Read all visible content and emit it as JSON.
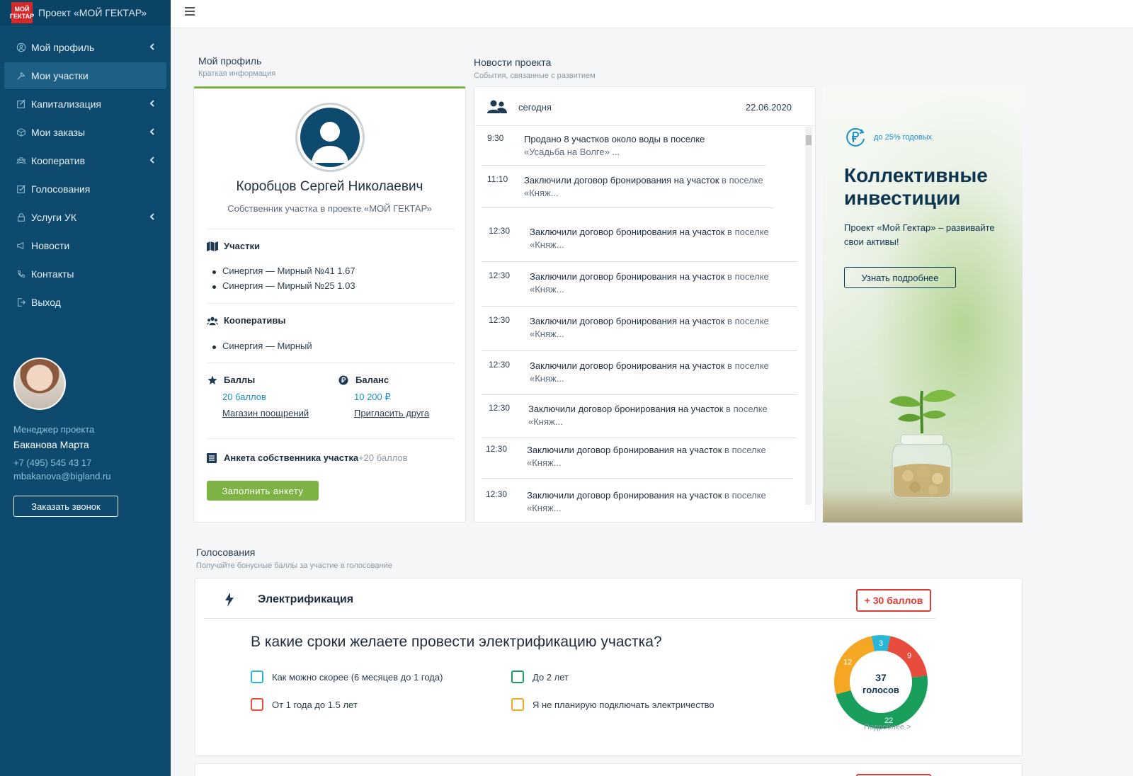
{
  "brand": {
    "logo_line1": "МОЙ",
    "logo_line2": "ГЕКТАР",
    "title": "Проект «МОЙ ГЕКТАР»"
  },
  "nav": [
    {
      "label": "Мой профиль",
      "icon": "person-circle-icon",
      "chevron": true
    },
    {
      "label": "Мои участки",
      "icon": "plot-icon",
      "chevron": false,
      "active": true
    },
    {
      "label": "Капитализация",
      "icon": "edit-square-icon",
      "chevron": true
    },
    {
      "label": "Мои заказы",
      "icon": "box-icon",
      "chevron": true
    },
    {
      "label": "Кооператив",
      "icon": "users-icon",
      "chevron": true
    },
    {
      "label": "Голосования",
      "icon": "checkbox-icon",
      "chevron": false
    },
    {
      "label": "Услуги УК",
      "icon": "lock-icon",
      "chevron": true
    },
    {
      "label": "Новости",
      "icon": "megaphone-icon",
      "chevron": false
    },
    {
      "label": "Контакты",
      "icon": "phone-icon",
      "chevron": false
    },
    {
      "label": "Выход",
      "icon": "exit-icon",
      "chevron": false
    }
  ],
  "manager": {
    "label": "Менеджер проекта",
    "name": "Баканова Марта",
    "phone": "+7 (495) 545 43 17",
    "email": "mbakanova@bigland.ru",
    "call_button": "Заказать звонок"
  },
  "profile_section": {
    "title": "Мой профиль",
    "subtitle": "Краткая информация"
  },
  "profile": {
    "name": "Коробцов Сергей Николаевич",
    "role": "Собственник участка в проекте «МОЙ ГЕКТАР»",
    "plots_title": "Участки",
    "plots": [
      "Синергия — Мирный №41 1.67",
      "Синергия — Мирный №25 1.03"
    ],
    "coops_title": "Кооперативы",
    "coops": [
      "Синергия — Мирный"
    ],
    "points_title": "Баллы",
    "points_value": "20 баллов",
    "points_link": "Магазин поощрений",
    "balance_title": "Баланс",
    "balance_value": "10 200 ₽",
    "balance_link": "Пригласить друга",
    "survey_title": "Анкета собственника участка",
    "survey_bonus": "+20 баллов",
    "survey_button": "Заполнить анкету"
  },
  "news_section": {
    "title": "Новости проекта",
    "subtitle": "События, связанные с развитием"
  },
  "news": {
    "day": "сегодня",
    "date": "22.06.2020",
    "items": [
      {
        "time": "9:30",
        "text": "Продано 8 участков около воды в поселке",
        "muted": "«Усадьба на Волге» ..."
      },
      {
        "time": "11:10",
        "text": "Заключили договор бронирования на участок",
        "muted": " в поселке «Княж..."
      },
      {
        "time": "12:30",
        "text": "Заключили договор бронирования на участок",
        "muted": " в поселке «Княж..."
      },
      {
        "time": "12:30",
        "text": "Заключили договор бронирования на участок",
        "muted": " в поселке «Княж..."
      },
      {
        "time": "12:30",
        "text": "Заключили договор бронирования на участок",
        "muted": " в поселке «Княж..."
      },
      {
        "time": "12:30",
        "text": "Заключили договор бронирования на участок",
        "muted": " в поселке «Княж..."
      },
      {
        "time": "12:30",
        "text": "Заключили договор бронирования на участок",
        "muted": " в поселке «Княж..."
      },
      {
        "time": "12:30",
        "text": "Заключили договор бронирования на участок",
        "muted": " в поселке «Княж..."
      },
      {
        "time": "12:30",
        "text": "Заключили договор бронирования на участок",
        "muted": " в поселке «Княж..."
      }
    ]
  },
  "banner": {
    "badge": "до 25% годовых",
    "title": "Коллективные инвестиции",
    "text": "Проект «Мой Гектар» – развивайте свои активы!",
    "button": "Узнать подробнее"
  },
  "voting_section": {
    "title": "Голосования",
    "subtitle": "Получайте бонусные баллы за участие в голосование"
  },
  "voting": {
    "title": "Электрификация",
    "badge": "+ 30 баллов",
    "question": "В какие сроки желаете провести электрификацию участка?",
    "options": [
      {
        "label": "Как можно скорее (6 месяцев до 1 года)",
        "color": "#29b6d8"
      },
      {
        "label": "От 1 года до 1.5 лет",
        "color": "#e74c3c"
      },
      {
        "label": "До 2 лет",
        "color": "#1a9e5c"
      },
      {
        "label": "Я не планирую подключать электричество",
        "color": "#f5a623"
      }
    ],
    "total_number": "37",
    "total_label": "голосов",
    "more": "Подробнее   >"
  },
  "chart_data": {
    "type": "pie",
    "categories": [
      "Как можно скорее (6 месяцев до 1 года)",
      "От 1 года до 1.5 лет",
      "До 2 лет",
      "Я не планирую подключать электричество"
    ],
    "values": [
      3,
      9,
      22,
      12
    ],
    "colors": [
      "#29b6d8",
      "#e74c3c",
      "#1a9e5c",
      "#f5a623"
    ]
  },
  "colors": {
    "sidebar": "#0d4a6e",
    "accent_green": "#7cb342",
    "accent_blue": "#1a8fc9",
    "badge_red": "#e53935"
  }
}
